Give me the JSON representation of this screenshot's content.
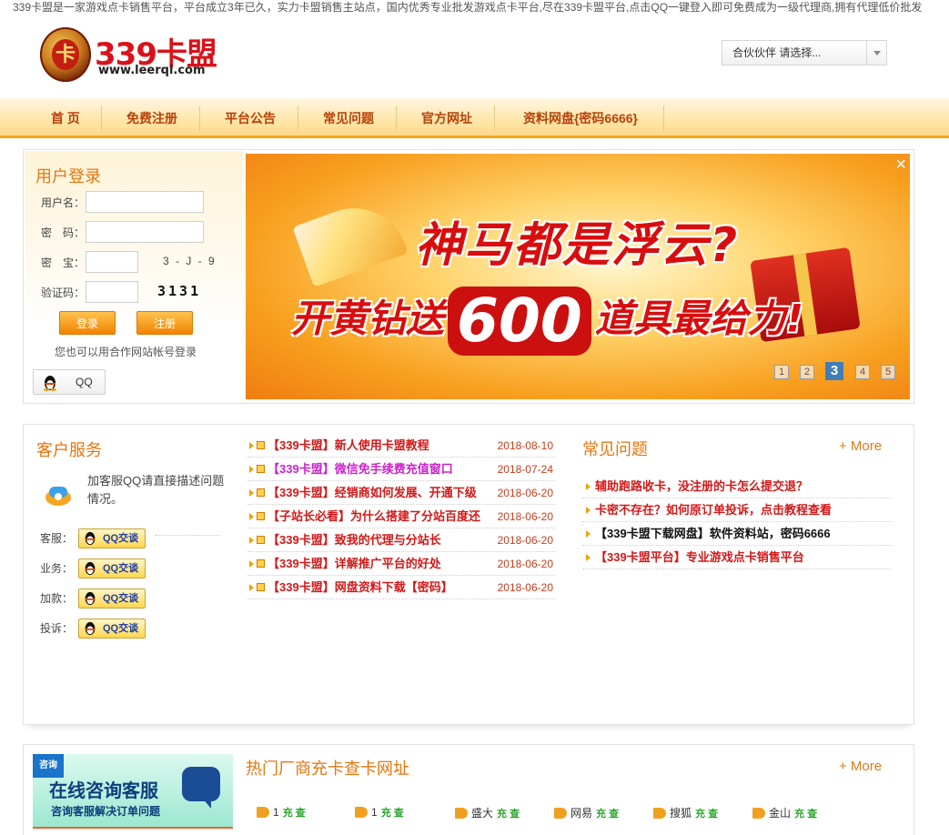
{
  "marquee": "339卡盟是一家游戏点卡销售平台，平台成立3年已久，实力卡盟销售主站点，国内优秀专业批发游戏点卡平台,尽在339卡盟平台,点击QQ一键登入即可免费成为一级代理商,拥有代理低价批发",
  "logo": {
    "coin_char": "卡",
    "name": "339卡盟",
    "url": "www.leerqi.com"
  },
  "partner_select": {
    "value": "合伙伙伴 请选择..."
  },
  "nav": [
    "首 页",
    "免费注册",
    "平台公告",
    "常见问题",
    "官方网址",
    "资料网盘{密码6666}"
  ],
  "login": {
    "title": "用户登录",
    "username_label": "用户名：",
    "password_label": "密　码：",
    "mibao_label": "密　宝：",
    "mibao_hint": "3 - J - 9",
    "captcha_label": "验证码：",
    "captcha_text": "3131",
    "login_button": "登录",
    "register_button": "注册",
    "other_login": "您也可以用合作网站帐号登录",
    "qq_button": "QQ"
  },
  "banner": {
    "close": "×",
    "headline": "神马都是浮云?",
    "line2_pre": "开黄钻送",
    "line2_number": "600",
    "line2_post": "道具最给力!",
    "pages": [
      "1",
      "2",
      "3",
      "4",
      "5"
    ],
    "active_page": "3"
  },
  "customer_service": {
    "title": "客户服务",
    "desc": "加客服QQ请直接描述问题情况。",
    "rows": [
      {
        "label": "客服：",
        "button": "QQ交谈"
      },
      {
        "label": "业务：",
        "button": "QQ交谈"
      },
      {
        "label": "加款：",
        "button": "QQ交谈"
      },
      {
        "label": "投诉：",
        "button": "QQ交谈"
      }
    ]
  },
  "news": [
    {
      "title": "【339卡盟】新人使用卡盟教程",
      "date": "2018-08-10",
      "color": "red"
    },
    {
      "title": "【339卡盟】微信免手续费充值窗口",
      "date": "2018-07-24",
      "color": "purple"
    },
    {
      "title": "【339卡盟】经销商如何发展、开通下级",
      "date": "2018-06-20",
      "color": "red"
    },
    {
      "title": "【子站长必看】为什么搭建了分站百度还",
      "date": "2018-06-20",
      "color": "red"
    },
    {
      "title": "【339卡盟】致我的代理与分站长",
      "date": "2018-06-20",
      "color": "red"
    },
    {
      "title": "【339卡盟】详解推广平台的好处",
      "date": "2018-06-20",
      "color": "red"
    },
    {
      "title": "【339卡盟】网盘资料下载【密码】",
      "date": "2018-06-20",
      "color": "red"
    }
  ],
  "faq": {
    "title": "常见问题",
    "more": "+ More",
    "items": [
      {
        "title": "辅助跑路收卡，没注册的卡怎么提交退？",
        "color": "red"
      },
      {
        "title": "卡密不存在？如何原订单投诉，点击教程查看",
        "color": "red"
      },
      {
        "title": "【339卡盟下载网盘】软件资料站，密码6666",
        "color": "black"
      },
      {
        "title": "【339卡盟平台】专业游戏点卡销售平台",
        "color": "red"
      }
    ]
  },
  "hot_vendors": {
    "title": "热门厂商充卡查卡网址",
    "more": "+ More",
    "consult_corner": "咨询",
    "consult_main": "在线咨询客服",
    "consult_sub": "咨询客服解决订单问题",
    "items": [
      {
        "name": "1",
        "badge": "充 查"
      },
      {
        "name": "1",
        "badge": "充 查"
      },
      {
        "name": "盛大",
        "badge": "充 查"
      },
      {
        "name": "网易",
        "badge": "充 查"
      },
      {
        "name": "搜狐",
        "badge": "充 查"
      },
      {
        "name": "金山",
        "badge": "充 查"
      }
    ]
  }
}
